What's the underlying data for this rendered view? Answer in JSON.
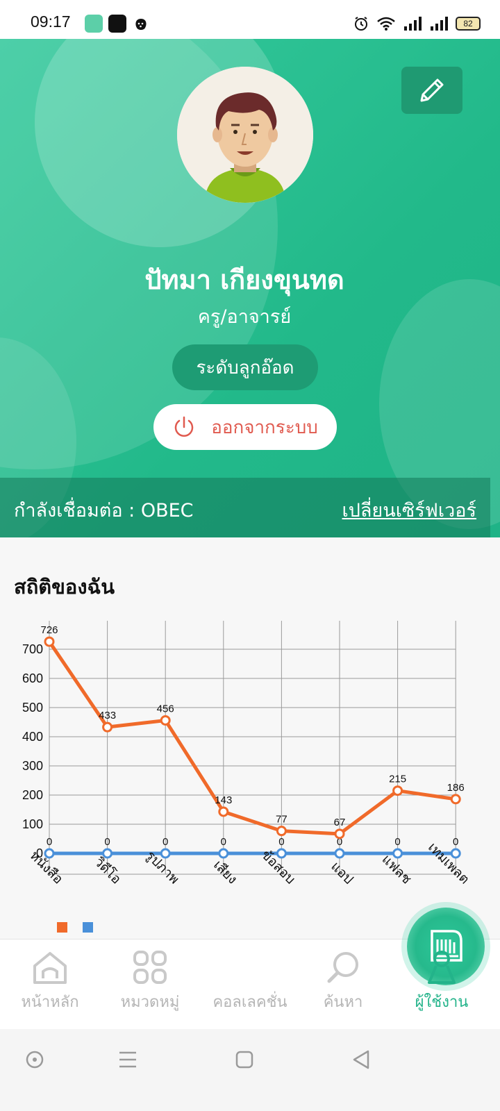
{
  "status_bar": {
    "time": "09:17",
    "battery": "82"
  },
  "profile": {
    "name": "ปัทมา เกียงขุนทด",
    "role": "ครู/อาจารย์",
    "level": "ระดับลูกอ๊อด",
    "logout_label": "ออกจากระบบ"
  },
  "server": {
    "connected_label": "กำลังเชื่อมต่อ : OBEC",
    "change_label": "เปลี่ยนเซิร์ฟเวอร์"
  },
  "stats": {
    "title": "สถิติของฉัน"
  },
  "chart_data": {
    "type": "line",
    "categories": [
      "หนังสือ",
      "วิดีโอ",
      "รูปภาพ",
      "เสียง",
      "ข้อสอบ",
      "แอป",
      "แฟลช",
      "เทมเพลต"
    ],
    "series": [
      {
        "values": [
          726,
          433,
          456,
          143,
          77,
          67,
          215,
          186
        ],
        "color": "#f06a2a"
      },
      {
        "values": [
          0,
          0,
          0,
          0,
          0,
          0,
          0,
          0
        ],
        "color": "#4a90d9"
      }
    ],
    "y_ticks": [
      0,
      100,
      200,
      300,
      400,
      500,
      600,
      700
    ],
    "ylim": [
      0,
      800
    ],
    "grid": true,
    "legend": "bottom-left"
  },
  "bottom_nav": {
    "items": [
      {
        "label": "หน้าหลัก",
        "icon": "home-icon"
      },
      {
        "label": "หมวดหมู่",
        "icon": "grid-icon"
      },
      {
        "label": "คอลเลคชั่น",
        "icon": "collection-icon"
      },
      {
        "label": "ค้นหา",
        "icon": "search-icon"
      },
      {
        "label": "ผู้ใช้งาน",
        "icon": "user-icon"
      }
    ],
    "active": 4
  }
}
